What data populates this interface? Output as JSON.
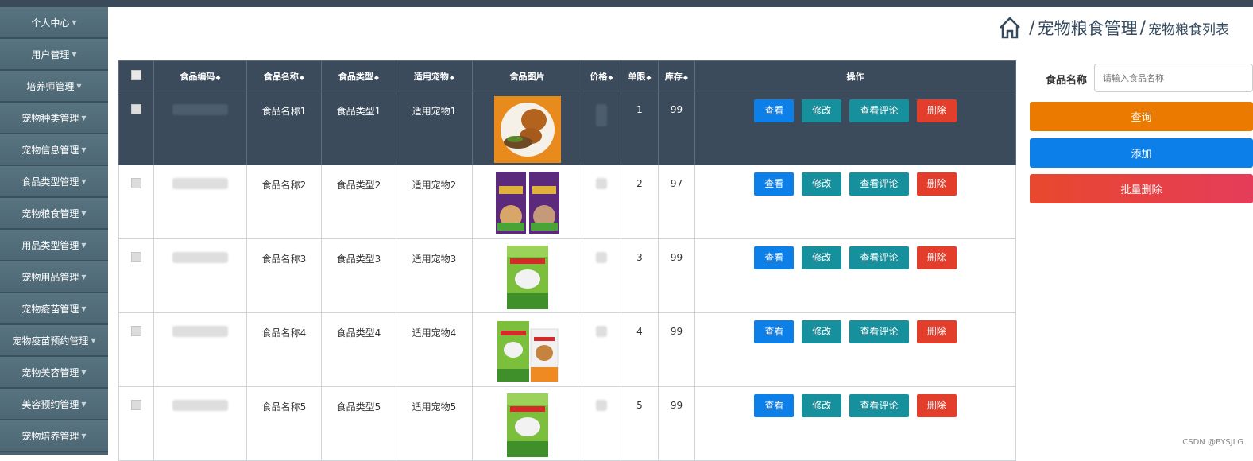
{
  "sidebar": {
    "items": [
      {
        "label": "个人中心"
      },
      {
        "label": "用户管理"
      },
      {
        "label": "培养师管理"
      },
      {
        "label": "宠物种类管理"
      },
      {
        "label": "宠物信息管理"
      },
      {
        "label": "食品类型管理"
      },
      {
        "label": "宠物粮食管理"
      },
      {
        "label": "用品类型管理"
      },
      {
        "label": "宠物用品管理"
      },
      {
        "label": "宠物疫苗管理"
      },
      {
        "label": "宠物疫苗预约管理"
      },
      {
        "label": "宠物美容管理"
      },
      {
        "label": "美容预约管理"
      },
      {
        "label": "宠物培养管理"
      }
    ]
  },
  "breadcrumb": {
    "main": "宠物粮食管理",
    "sub": "宠物粮食列表",
    "sep": "/"
  },
  "table": {
    "headers": [
      "食品编码",
      "食品名称",
      "食品类型",
      "适用宠物",
      "食品图片",
      "价格",
      "单限",
      "库存",
      "操作"
    ],
    "rows": [
      {
        "name": "食品名称1",
        "type": "食品类型1",
        "pet": "适用宠物1",
        "limit": "1",
        "stock": "99"
      },
      {
        "name": "食品名称2",
        "type": "食品类型2",
        "pet": "适用宠物2",
        "limit": "2",
        "stock": "97"
      },
      {
        "name": "食品名称3",
        "type": "食品类型3",
        "pet": "适用宠物3",
        "limit": "3",
        "stock": "99"
      },
      {
        "name": "食品名称4",
        "type": "食品类型4",
        "pet": "适用宠物4",
        "limit": "4",
        "stock": "99"
      },
      {
        "name": "食品名称5",
        "type": "食品类型5",
        "pet": "适用宠物5",
        "limit": "5",
        "stock": "99"
      }
    ],
    "actions": {
      "view": "查看",
      "edit": "修改",
      "comments": "查看评论",
      "delete": "删除"
    }
  },
  "search": {
    "label": "食品名称",
    "placeholder": "请输入食品名称"
  },
  "buttons": {
    "query": "查询",
    "add": "添加",
    "batch_delete": "批量删除"
  },
  "watermark": "CSDN @BYSJLG",
  "colors": {
    "header": "#3b4b5c",
    "blue": "#0d7fe8",
    "teal": "#17909e",
    "red": "#e33d2c",
    "orange": "#ea7b00"
  }
}
